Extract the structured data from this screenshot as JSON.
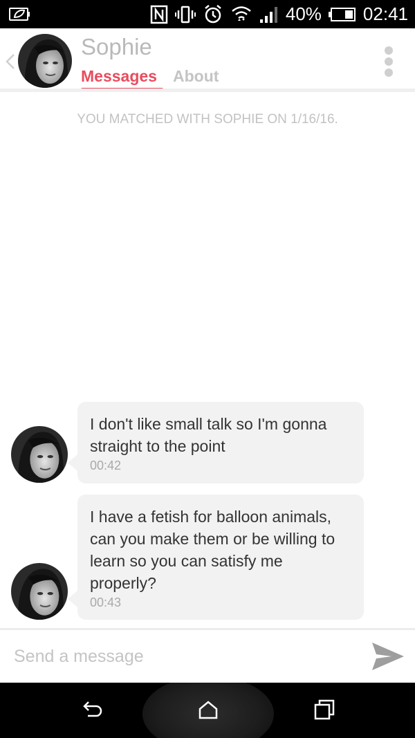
{
  "status_bar": {
    "battery_percent": "40%",
    "time": "02:41",
    "icons": [
      "leaf-battery-icon",
      "nfc-icon",
      "vibrate-icon",
      "alarm-icon",
      "wifi-icon",
      "signal-icon",
      "battery-icon"
    ]
  },
  "header": {
    "contact_name": "Sophie",
    "tabs": [
      {
        "label": "Messages",
        "active": true
      },
      {
        "label": "About",
        "active": false
      }
    ]
  },
  "match_notice": "YOU MATCHED WITH SOPHIE ON 1/16/16.",
  "messages": [
    {
      "text": "I don't like small talk so I'm gonna straight to the point",
      "time": "00:42"
    },
    {
      "text": "I have a fetish for balloon animals, can you make them or be willing to learn so you can satisfy me properly?",
      "time": "00:43"
    }
  ],
  "composer": {
    "placeholder": "Send a message"
  },
  "colors": {
    "accent": "#e84c5e",
    "bubble": "#f2f2f2",
    "muted": "#c2c2c2"
  }
}
